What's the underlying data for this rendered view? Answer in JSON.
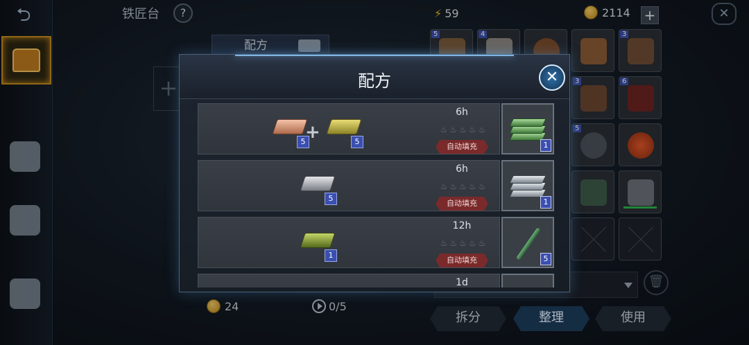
{
  "background": {
    "screen_title": "铁匠台",
    "help_label": "?",
    "recipe_tab_label": "配方",
    "add_label": "+",
    "energy": "59",
    "gold": "2114",
    "plus_label": "+",
    "close_label": "✕",
    "bottom_coin": "24",
    "bottom_plays": "0/5",
    "actions": [
      {
        "label": "拆分"
      },
      {
        "label": "整理"
      },
      {
        "label": "使用"
      }
    ],
    "inventory_counts": [
      "5",
      "4",
      "",
      "",
      "3",
      "",
      "3",
      "6",
      "",
      "",
      "5",
      "",
      "",
      "",
      "",
      "",
      ""
    ]
  },
  "modal": {
    "title": "配方",
    "close_label": "✕",
    "recipes": [
      {
        "time": "6h",
        "flames": "♨♨♨♨♨",
        "autofill": "自动填充",
        "ingredients": [
          {
            "type": "copper",
            "count": "5"
          },
          {
            "type": "gold",
            "count": "5"
          }
        ],
        "product": {
          "type": "green-plates",
          "count": "1"
        }
      },
      {
        "time": "6h",
        "flames": "♨♨♨♨♨",
        "autofill": "自动填充",
        "ingredients": [
          {
            "type": "iron",
            "count": "5"
          }
        ],
        "product": {
          "type": "steel-plates",
          "count": "1"
        }
      },
      {
        "time": "12h",
        "flames": "♨♨♨♨♨",
        "autofill": "自动填充",
        "ingredients": [
          {
            "type": "jade",
            "count": "1"
          }
        ],
        "product": {
          "type": "jade-needle",
          "count": "5"
        }
      },
      {
        "time": "1d"
      }
    ]
  },
  "colors": {
    "accent_blue": "#2e6fa8",
    "autofill_red": "#7a2a2a",
    "count_badge": "#3a4fb0",
    "gold_frame": "#c38a1c"
  }
}
